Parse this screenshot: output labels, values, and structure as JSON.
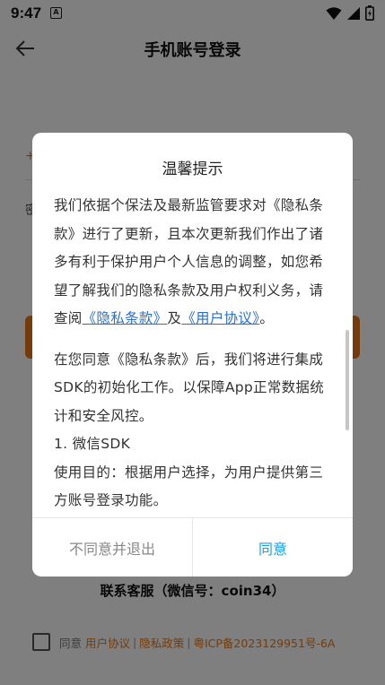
{
  "status_bar": {
    "time": "9:47",
    "notification_glyph": "A"
  },
  "header": {
    "title": "手机账号登录"
  },
  "background": {
    "field_hint": "+",
    "field_label": "密",
    "contact": "联系客服（微信号：coin34）",
    "agreement": {
      "prefix": "同意",
      "user_agreement": "用户协议",
      "separator": "|",
      "privacy_policy": "隐私政策",
      "icp": "粤ICP备2023129951号-6A"
    }
  },
  "dialog": {
    "title": "温馨提示",
    "p1_text": "我们依据个保法及最新监管要求对《隐私条款》进行了更新，且本次更新我们作出了诸多有利于保护用户个人信息的调整，如您希望了解我们的隐私条款及用户权利义务，请查阅",
    "p1_link1": "《隐私条款》",
    "p1_and": "及",
    "p1_link2": "《用户协议》",
    "p1_end": "。",
    "p2": "在您同意《隐私条款》后，我们将进行集成SDK的初始化工作。以保障App正常数据统计和安全风控。",
    "p3_title": "1. 微信SDK",
    "p3_text": "使用目的：根据用户选择，为用户提供第三方账号登录功能。",
    "disagree_label": "不同意并退出",
    "agree_label": "同意"
  },
  "colors": {
    "accent": "#e8781a",
    "link": "#2a6fd0",
    "agree": "#1aa0e8"
  }
}
